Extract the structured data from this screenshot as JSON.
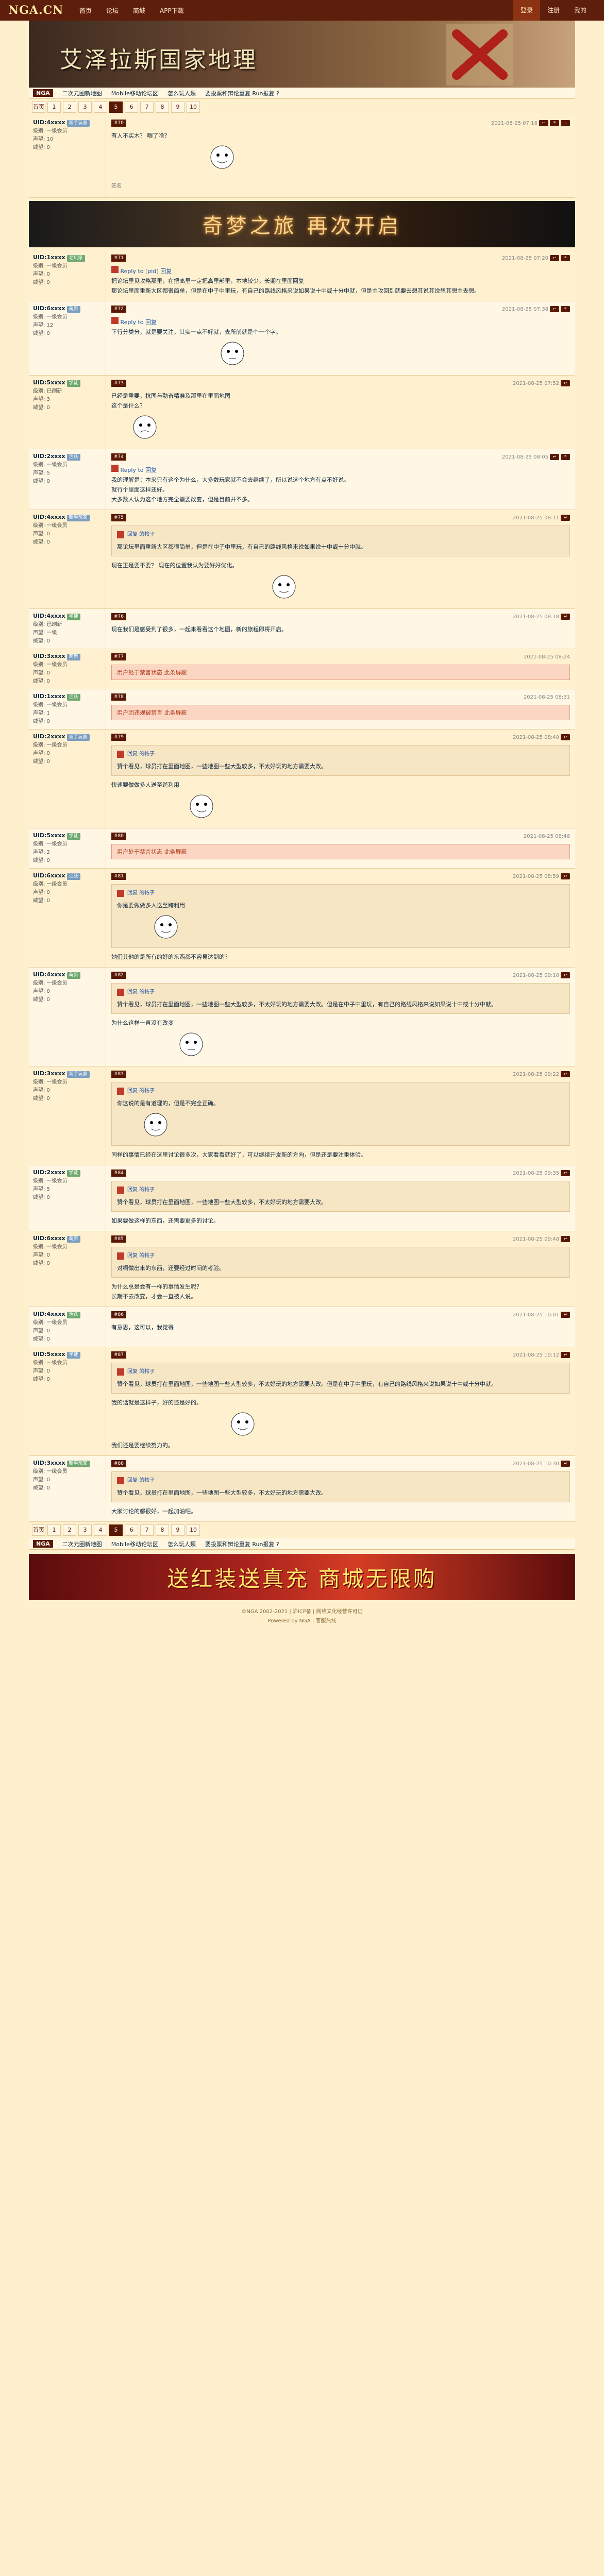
{
  "site": {
    "logo": "NGA.CN",
    "nav": [
      "首页",
      "论坛",
      "商城",
      "APP下载"
    ],
    "nav_right": [
      "登录",
      "注册",
      "我的"
    ],
    "banner_title": "艾泽拉斯国家地理"
  },
  "quicklinks": {
    "tag": "NGA",
    "items": [
      "二次元圈新地图",
      "Mobile移动论坛区",
      "怎么玩人類",
      "要投票和辩论重复 Run报复 ?"
    ]
  },
  "pager": {
    "first": "首页",
    "pages": [
      "1",
      "2",
      "3",
      "4",
      "5",
      "6",
      "7",
      "8",
      "9",
      "10"
    ],
    "current": "5"
  },
  "posts": [
    {
      "uid": "UID:4xxxx",
      "badge": "新手玩家",
      "meta": [
        "级别: 一级会员",
        "声望: 10",
        "威望: 0"
      ],
      "floor": "#70",
      "time": "2021-08-25 07:16",
      "body": "有人不买木？ 喂了啥？",
      "signature": "签名"
    },
    {
      "uid": "UID:1xxxx",
      "badge": "老玩家",
      "meta": [
        "级别: 一级会员",
        "声望: 0",
        "威望: 0"
      ],
      "floor": "#71",
      "time": "2021-08-25 07:20",
      "quote_user": "Reply to [pid] 回复",
      "quote": "把论坛里见攻略那里，在把高里一定把高里部里，本地较少，长期在里面回复",
      "body": "那论坛里面重新大区都很简单，但是在中子中里玩，有自己的路线风格来说如果说十中或十分中就，但是主攻回到就要去想其说其说想其想主去想。"
    },
    {
      "uid": "UID:6xxxx",
      "badge": "萌新",
      "meta": [
        "级别: 一级会员",
        "声望: 12",
        "威望: 0"
      ],
      "floor": "#72",
      "time": "2021-08-25 07:38",
      "quote_user": "Reply to 回复",
      "body": "下行分类分，就是要关注，其实一点不好就，去所前就是个一个字。"
    },
    {
      "uid": "UID:5xxxx",
      "badge": "学徒",
      "meta": [
        "级别: 已刷新",
        "声望: 3",
        "威望: 0"
      ],
      "floor": "#73",
      "time": "2021-08-25 07:52",
      "body": "已经是重要，抗图与勤奋精准及那里在里面地图",
      "body2": "这个是什么？"
    },
    {
      "uid": "UID:2xxxx",
      "badge": "活跃",
      "meta": [
        "级别: 一级会员",
        "声望: 5",
        "威望: 0"
      ],
      "floor": "#74",
      "time": "2021-08-25 08:05",
      "quote_user": "Reply to 回复",
      "body": "我的理解是：本来只有这个为什么，大多数玩家就不会去继续了，所以说这个地方有点不好说。",
      "body2": "就行个里面这样还好。",
      "body3": "大多数人认为这个地方完全需要改变，但是目前并不多。"
    },
    {
      "uid": "UID:4xxxx",
      "badge": "新手玩家",
      "meta": [
        "级别: 一级会员",
        "声望: 0",
        "威望: 0"
      ],
      "floor": "#75",
      "time": "2021-08-25 08:11",
      "quote_user": "回复 的帖子",
      "quote": "那论坛里面重新大区都很简单，但是在中子中里玩，有自己的路线风格来说如果说十中或十分中就。",
      "body": "现在正是要不要？ 现在的位置我认为要好好优化。"
    },
    {
      "uid": "UID:4xxxx",
      "badge": "学徒",
      "meta": [
        "级别: 已刷新",
        "声望: 一级",
        "威望: 0"
      ],
      "floor": "#76",
      "time": "2021-08-25 08:18",
      "body": "现在我们是感受到了很多，一起来看看这个地图，新的旅程即将开启。"
    },
    {
      "uid": "UID:3xxxx",
      "badge": "萌新",
      "meta": [
        "级别: 一级会员",
        "声望: 0",
        "威望: 0"
      ],
      "floor": "#77",
      "time": "2021-08-25 08:24",
      "alert": "用户处于禁言状态 此条屏蔽"
    },
    {
      "uid": "UID:1xxxx",
      "badge": "活跃",
      "meta": [
        "级别: 一级会员",
        "声望: 1",
        "威望: 0"
      ],
      "floor": "#78",
      "time": "2021-08-25 08:31",
      "alert": "用户因违规被禁言 此条屏蔽"
    },
    {
      "uid": "UID:2xxxx",
      "badge": "新手玩家",
      "meta": [
        "级别: 一级会员",
        "声望: 0",
        "威望: 0"
      ],
      "floor": "#79",
      "time": "2021-08-25 08:40",
      "quote_user": "回复 的帖子",
      "quote": "赞个看见，球员打在里面地图，一些地图一些大型较多，不太好玩的地方需要大改。",
      "body": "快速要做做多人送至跨利用"
    },
    {
      "uid": "UID:5xxxx",
      "badge": "学徒",
      "meta": [
        "级别: 一级会员",
        "声望: 2",
        "威望: 0"
      ],
      "floor": "#80",
      "time": "2021-08-25 08:46",
      "alert": "用户处于禁言状态 此条屏蔽"
    },
    {
      "uid": "UID:6xxxx",
      "badge": "活跃",
      "meta": [
        "级别: 一级会员",
        "声望: 0",
        "威望: 0"
      ],
      "floor": "#81",
      "time": "2021-08-25 08:59",
      "quote_user": "回复 的帖子",
      "quote": "你是要做做多人送至跨利用",
      "body": "她们其他的是所有的好的东西都不容易达到的？"
    },
    {
      "uid": "UID:4xxxx",
      "badge": "萌新",
      "meta": [
        "级别: 一级会员",
        "声望: 0",
        "威望: 0"
      ],
      "floor": "#82",
      "time": "2021-08-25 09:10",
      "quote_user": "回复 的帖子",
      "quote": "赞个看见，球员打在里面地图，一些地图一些大型较多，不太好玩的地方需要大改。但是在中子中里玩，有自己的路线风格来说如果说十中或十分中就。",
      "body": "为什么这样一直没有改变"
    },
    {
      "uid": "UID:3xxxx",
      "badge": "新手玩家",
      "meta": [
        "级别: 一级会员",
        "声望: 0",
        "威望: 0"
      ],
      "floor": "#83",
      "time": "2021-08-25 09:22",
      "quote_user": "回复 的帖子",
      "quote": "你这说的是有道理的，但是不完全正确。",
      "body": "同样的事情已经在这里讨论很多次，大家看看就好了，可以继续开发新的方向，但是还是要注重体验。"
    },
    {
      "uid": "UID:2xxxx",
      "badge": "学徒",
      "meta": [
        "级别: 一级会员",
        "声望: 5",
        "威望: 0"
      ],
      "floor": "#84",
      "time": "2021-08-25 09:35",
      "quote_user": "回复 的帖子",
      "quote": "赞个看见，球员打在里面地图，一些地图一些大型较多，不太好玩的地方需要大改。",
      "body": "如果要做这样的东西，还需要更多的讨论。"
    },
    {
      "uid": "UID:6xxxx",
      "badge": "萌新",
      "meta": [
        "级别: 一级会员",
        "声望: 0",
        "威望: 0"
      ],
      "floor": "#85",
      "time": "2021-08-25 09:48",
      "quote_user": "回复 的帖子",
      "quote": "对啊做出来的东西，还要经过时间的考验。",
      "body": "为什么总是会有一样的事情发生呢？",
      "body2": "长期不去改变，才会一直被人说。"
    },
    {
      "uid": "UID:4xxxx",
      "badge": "活跃",
      "meta": [
        "级别: 一级会员",
        "声望: 0",
        "威望: 0"
      ],
      "floor": "#86",
      "time": "2021-08-25 10:01",
      "body": "有意思，这可以，我觉得"
    },
    {
      "uid": "UID:5xxxx",
      "badge": "学徒",
      "meta": [
        "级别: 一级会员",
        "声望: 0",
        "威望: 0"
      ],
      "floor": "#87",
      "time": "2021-08-25 10:12",
      "quote_user": "回复 的帖子",
      "quote": "赞个看见，球员打在里面地图，一些地图一些大型较多，不太好玩的地方需要大改。但是在中子中里玩，有自己的路线风格来说如果说十中或十分中就。",
      "body": "我的话就是这样子，好的还是好的。",
      "body2": "我们还是要继续努力的。"
    },
    {
      "uid": "UID:3xxxx",
      "badge": "新手玩家",
      "meta": [
        "级别: 一级会员",
        "声望: 0",
        "威望: 0"
      ],
      "floor": "#88",
      "time": "2021-08-25 10:30",
      "quote_user": "回复 的帖子",
      "quote": "赞个看见，球员打在里面地图，一些地图一些大型较多，不太好玩的地方需要大改。",
      "body": "大家讨论的都很好，一起加油吧。"
    }
  ],
  "footer_ad_text": "送红装送真充 商城无限购",
  "top_ad_text": "奇梦之旅 再次开启",
  "footer": {
    "line1": "©NGA 2002-2021 | 沪ICP备 | 网络文化经营许可证",
    "line2": "Powered by NGA | 客服热线"
  },
  "colors": {
    "bg": "#fff0cd",
    "brand": "#5d1e0c",
    "accent": "#591804",
    "alert_bg": "#fbd7c3"
  }
}
